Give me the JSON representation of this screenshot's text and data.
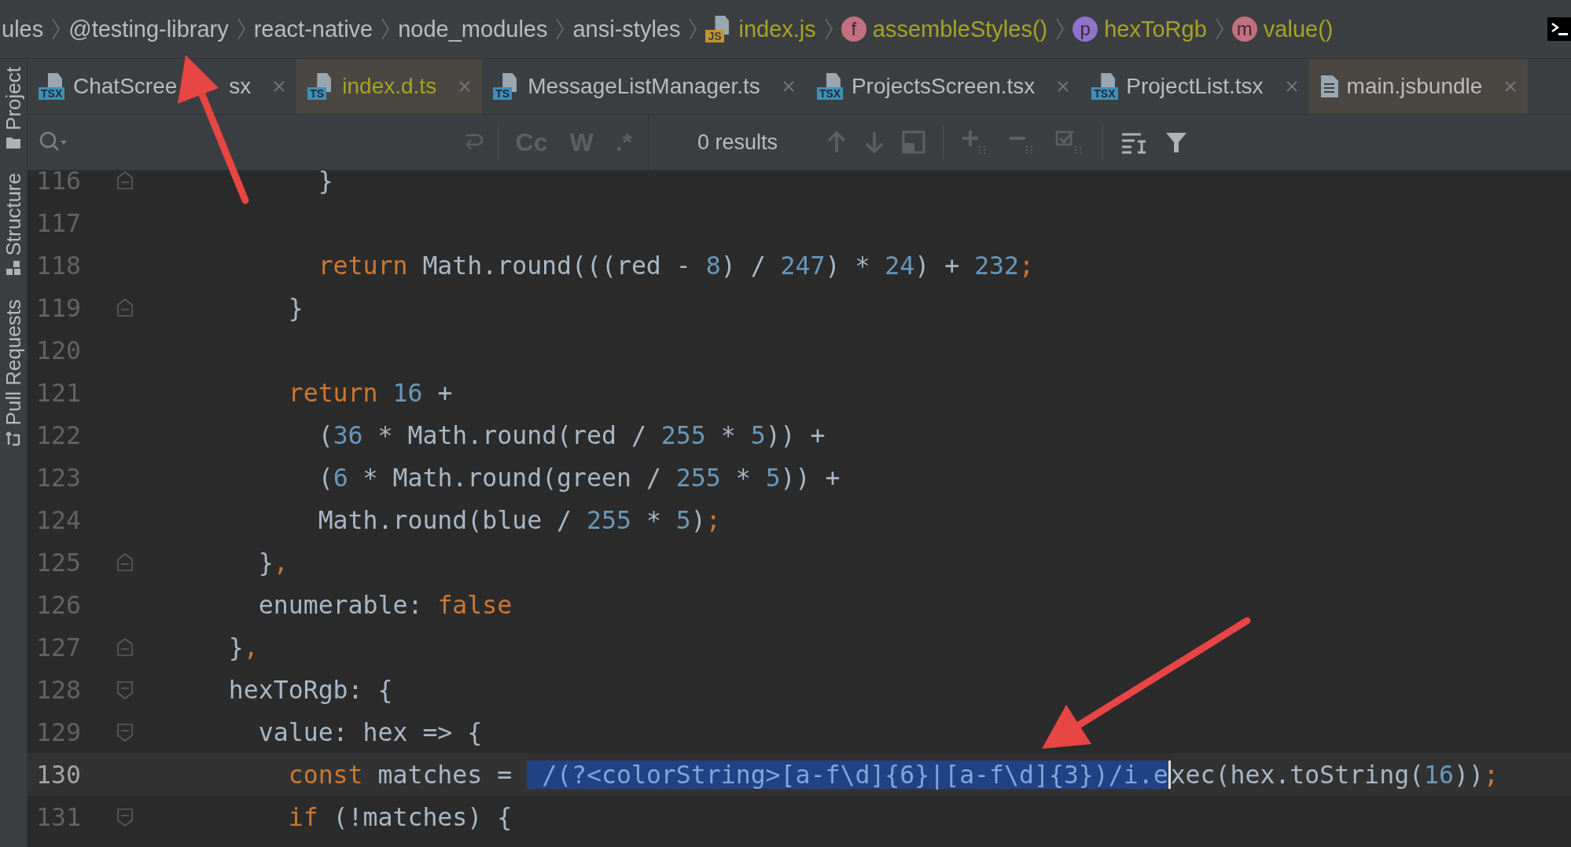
{
  "breadcrumbs": [
    {
      "label": "ules",
      "kind": "folder"
    },
    {
      "label": "@testing-library",
      "kind": "folder"
    },
    {
      "label": "react-native",
      "kind": "folder"
    },
    {
      "label": "node_modules",
      "kind": "folder"
    },
    {
      "label": "ansi-styles",
      "kind": "folder"
    },
    {
      "label": "index.js",
      "kind": "file-js",
      "badge": "JS"
    },
    {
      "label": "assembleStyles()",
      "kind": "symbol",
      "badge": "f",
      "color": "#c27080"
    },
    {
      "label": "hexToRgb",
      "kind": "symbol",
      "badge": "p",
      "color": "#8e73c9"
    },
    {
      "label": "value()",
      "kind": "symbol",
      "badge": "m",
      "color": "#c27080"
    }
  ],
  "tabs": [
    {
      "label": "ChatScree",
      "label_tail": "sx",
      "kind": "tsx",
      "badge": "TSX",
      "selected": false,
      "color": "#bbbbbb"
    },
    {
      "label": "index.d.ts",
      "kind": "ts",
      "badge": "TS",
      "selected": true,
      "color": "#a7a224"
    },
    {
      "label": "MessageListManager.ts",
      "kind": "ts",
      "badge": "TS",
      "selected": false,
      "color": "#bbbbbb"
    },
    {
      "label": "ProjectsScreen.tsx",
      "kind": "tsx",
      "badge": "TSX",
      "selected": false,
      "color": "#bbbbbb"
    },
    {
      "label": "ProjectList.tsx",
      "kind": "tsx",
      "badge": "TSX",
      "selected": false,
      "color": "#bbbbbb"
    },
    {
      "label": "main.jsbundle",
      "kind": "file",
      "selected": true,
      "color": "#bbbbbb"
    }
  ],
  "side_tools": [
    {
      "label": "Project",
      "kind": "folder"
    },
    {
      "label": "Structure",
      "kind": "structure"
    },
    {
      "label": "Pull Requests",
      "kind": "pull"
    }
  ],
  "search": {
    "options": [
      "Cc",
      "W",
      ".*"
    ],
    "results": "0 results"
  },
  "lines": [
    {
      "number": "116",
      "kind": "fold-end",
      "current": false,
      "tokens": [
        {
          "kind": "text",
          "text": "          }"
        }
      ]
    },
    {
      "number": "117",
      "kind": "plain",
      "current": false
    },
    {
      "number": "118",
      "kind": "plain",
      "current": false,
      "tokens": [
        {
          "kind": "kw",
          "text": "          return"
        },
        {
          "kind": "text",
          "text": " Math.round(((red - "
        },
        {
          "kind": "num",
          "text": "8"
        },
        {
          "kind": "text",
          "text": ") / "
        },
        {
          "kind": "num",
          "text": "247"
        },
        {
          "kind": "text",
          "text": ") * "
        },
        {
          "kind": "num",
          "text": "24"
        },
        {
          "kind": "text",
          "text": ") + "
        },
        {
          "kind": "num",
          "text": "232"
        },
        {
          "kind": "kw",
          "text": ";"
        }
      ]
    },
    {
      "number": "119",
      "kind": "fold-end",
      "current": false,
      "tokens": [
        {
          "kind": "text",
          "text": "        }"
        }
      ]
    },
    {
      "number": "120",
      "kind": "plain",
      "current": false
    },
    {
      "number": "121",
      "kind": "plain",
      "current": false,
      "tokens": [
        {
          "kind": "kw",
          "text": "        return"
        },
        {
          "kind": "num",
          "text": " 16"
        },
        {
          "kind": "text",
          "text": " +"
        }
      ]
    },
    {
      "number": "122",
      "kind": "plain",
      "current": false,
      "tokens": [
        {
          "kind": "text",
          "text": "          ("
        },
        {
          "kind": "num",
          "text": "36"
        },
        {
          "kind": "text",
          "text": " * Math.round(red / "
        },
        {
          "kind": "num",
          "text": "255"
        },
        {
          "kind": "text",
          "text": " * "
        },
        {
          "kind": "num",
          "text": "5"
        },
        {
          "kind": "text",
          "text": ")) +"
        }
      ]
    },
    {
      "number": "123",
      "kind": "plain",
      "current": false,
      "tokens": [
        {
          "kind": "text",
          "text": "          ("
        },
        {
          "kind": "num",
          "text": "6"
        },
        {
          "kind": "text",
          "text": " * Math.round(green / "
        },
        {
          "kind": "num",
          "text": "255"
        },
        {
          "kind": "text",
          "text": " * "
        },
        {
          "kind": "num",
          "text": "5"
        },
        {
          "kind": "text",
          "text": ")) +"
        }
      ]
    },
    {
      "number": "124",
      "kind": "plain",
      "current": false,
      "tokens": [
        {
          "kind": "text",
          "text": "          Math.round(blue / "
        },
        {
          "kind": "num",
          "text": "255"
        },
        {
          "kind": "text",
          "text": " * "
        },
        {
          "kind": "num",
          "text": "5"
        },
        {
          "kind": "text",
          "text": ")"
        },
        {
          "kind": "kw",
          "text": ";"
        }
      ]
    },
    {
      "number": "125",
      "kind": "fold-end",
      "current": false,
      "tokens": [
        {
          "kind": "text",
          "text": "      }"
        },
        {
          "kind": "kw",
          "text": ","
        }
      ]
    },
    {
      "number": "126",
      "kind": "plain",
      "current": false,
      "tokens": [
        {
          "kind": "text",
          "text": "      enumerable: "
        },
        {
          "kind": "kw",
          "text": "false"
        }
      ]
    },
    {
      "number": "127",
      "kind": "fold-end",
      "current": false,
      "tokens": [
        {
          "kind": "text",
          "text": "    }"
        },
        {
          "kind": "kw",
          "text": ","
        }
      ]
    },
    {
      "number": "128",
      "kind": "fold-start",
      "current": false,
      "tokens": [
        {
          "kind": "text",
          "text": "    hexToRgb: {"
        }
      ]
    },
    {
      "number": "129",
      "kind": "fold-start",
      "current": false,
      "tokens": [
        {
          "kind": "text",
          "text": "      value: hex => {"
        }
      ]
    },
    {
      "number": "130",
      "kind": "plain",
      "current": true,
      "tokens": [
        {
          "kind": "kw",
          "text": "        const"
        },
        {
          "kind": "text",
          "text": " matches = "
        },
        {
          "kind": "sel",
          "text": " /(?<colorString>[a-f\\d]{6}|[a-f\\d]{3})/i.e"
        },
        {
          "kind": "text",
          "text": "xec(hex.toString("
        },
        {
          "kind": "num",
          "text": "16"
        },
        {
          "kind": "text",
          "text": "))"
        },
        {
          "kind": "kw",
          "text": ";"
        }
      ]
    },
    {
      "number": "131",
      "kind": "fold-start",
      "current": false,
      "tokens": [
        {
          "kind": "kw",
          "text": "        if"
        },
        {
          "kind": "text",
          "text": " (!matches) {"
        }
      ]
    }
  ]
}
